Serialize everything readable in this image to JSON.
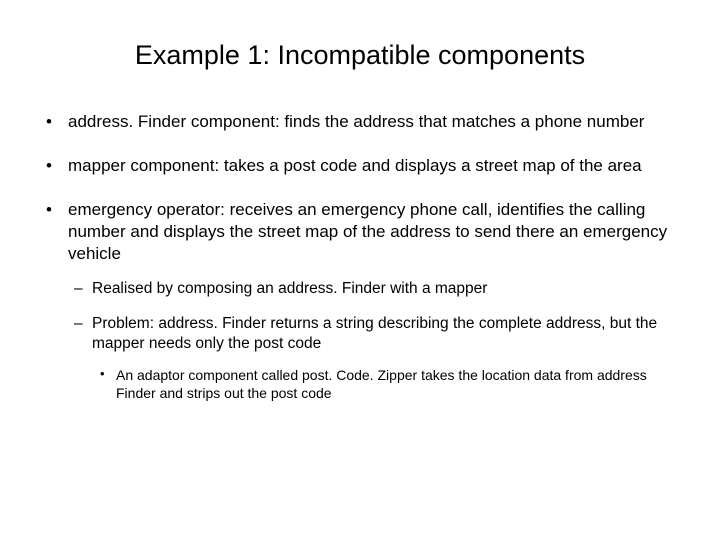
{
  "title": "Example 1: Incompatible components",
  "bullets": [
    {
      "text": "address. Finder component: finds the address that matches a phone number"
    },
    {
      "text": "mapper component: takes a post code and displays a street map of the area"
    },
    {
      "text": "emergency operator: receives an emergency phone call, identifies the calling number and displays the street map of the address to send there an emergency vehicle",
      "subs": [
        {
          "text": "Realised by composing an address. Finder with a mapper"
        },
        {
          "text": "Problem: address. Finder returns a string describing the complete address, but the mapper needs only the post code",
          "subsubs": [
            {
              "text": "An adaptor component called post. Code. Zipper takes the location data from address Finder and strips out the post code"
            }
          ]
        }
      ]
    }
  ]
}
